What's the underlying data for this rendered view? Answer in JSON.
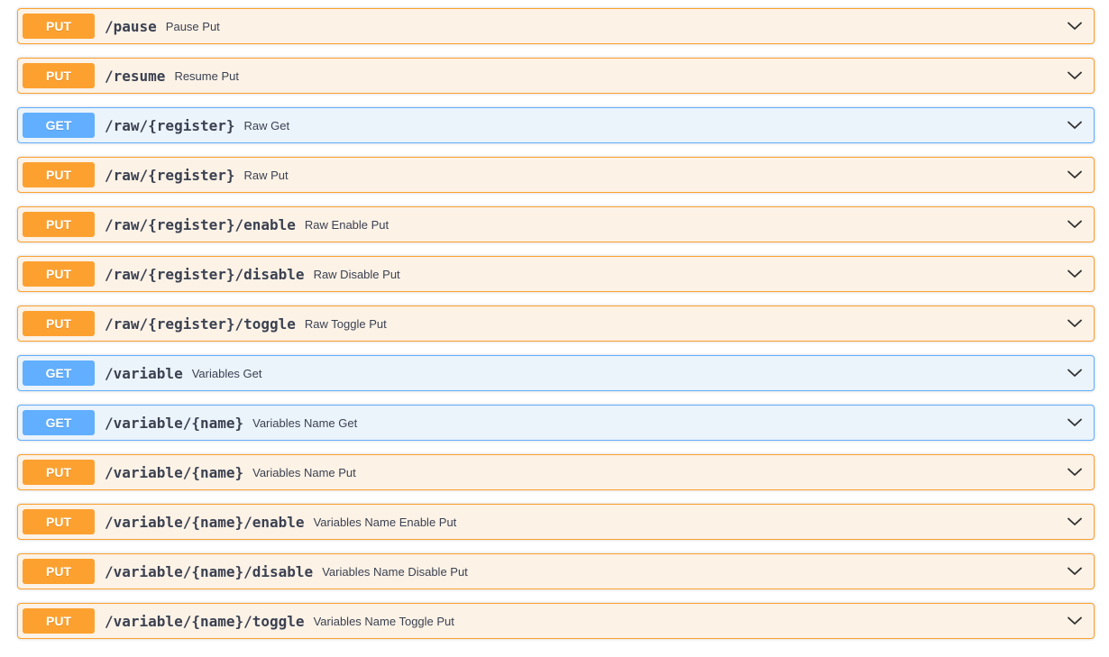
{
  "colors": {
    "put": "#fca130",
    "put_bg": "#fcf2e6",
    "get": "#61affe",
    "get_bg": "#ebf3fb",
    "text": "#3b4151"
  },
  "operations": [
    {
      "method": "PUT",
      "path": "/pause",
      "summary": "Pause Put",
      "icon": "chevron-down-icon"
    },
    {
      "method": "PUT",
      "path": "/resume",
      "summary": "Resume Put",
      "icon": "chevron-down-icon"
    },
    {
      "method": "GET",
      "path": "/raw/{register}",
      "summary": "Raw Get",
      "icon": "chevron-down-icon"
    },
    {
      "method": "PUT",
      "path": "/raw/{register}",
      "summary": "Raw Put",
      "icon": "chevron-down-icon"
    },
    {
      "method": "PUT",
      "path": "/raw/{register}/enable",
      "summary": "Raw Enable Put",
      "icon": "chevron-down-icon"
    },
    {
      "method": "PUT",
      "path": "/raw/{register}/disable",
      "summary": "Raw Disable Put",
      "icon": "chevron-down-icon"
    },
    {
      "method": "PUT",
      "path": "/raw/{register}/toggle",
      "summary": "Raw Toggle Put",
      "icon": "chevron-down-icon"
    },
    {
      "method": "GET",
      "path": "/variable",
      "summary": "Variables Get",
      "icon": "chevron-down-icon"
    },
    {
      "method": "GET",
      "path": "/variable/{name}",
      "summary": "Variables Name Get",
      "icon": "chevron-down-icon"
    },
    {
      "method": "PUT",
      "path": "/variable/{name}",
      "summary": "Variables Name Put",
      "icon": "chevron-down-icon"
    },
    {
      "method": "PUT",
      "path": "/variable/{name}/enable",
      "summary": "Variables Name Enable Put",
      "icon": "chevron-down-icon"
    },
    {
      "method": "PUT",
      "path": "/variable/{name}/disable",
      "summary": "Variables Name Disable Put",
      "icon": "chevron-down-icon"
    },
    {
      "method": "PUT",
      "path": "/variable/{name}/toggle",
      "summary": "Variables Name Toggle Put",
      "icon": "chevron-down-icon"
    }
  ]
}
